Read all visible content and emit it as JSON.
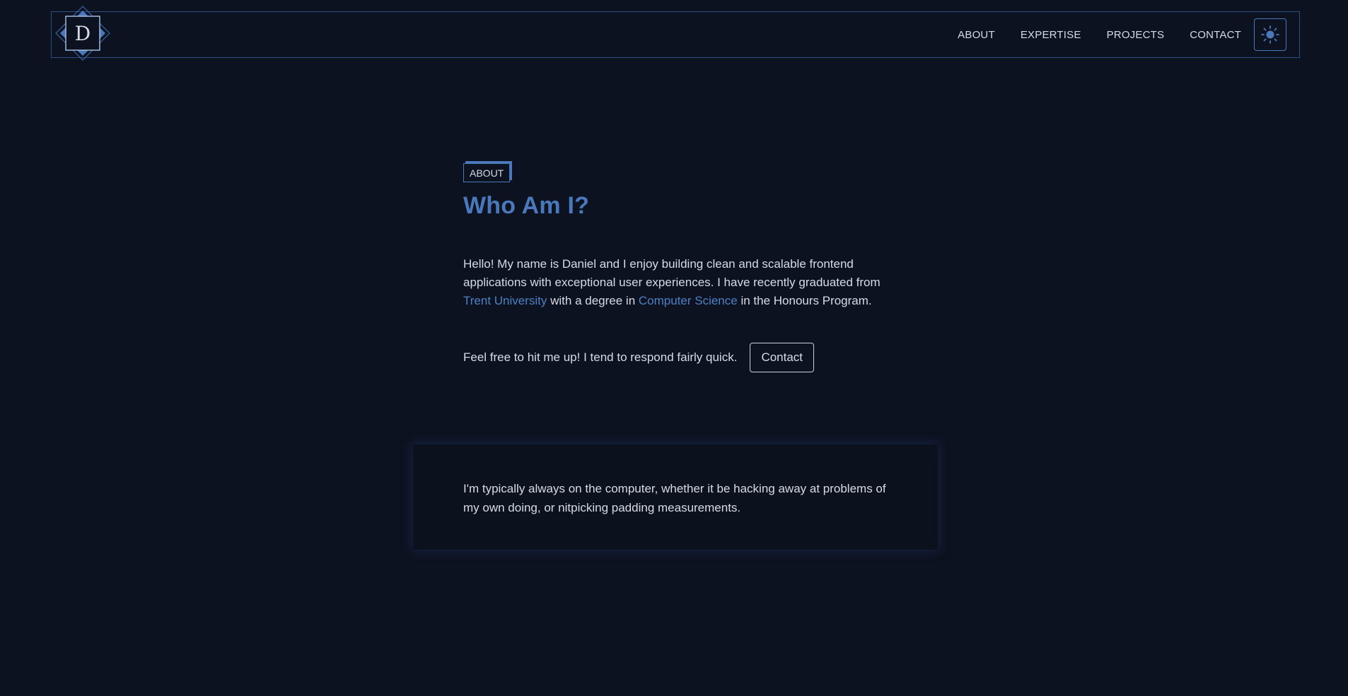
{
  "logo": {
    "letter": "D",
    "icon": "diamond-logo-icon"
  },
  "nav": {
    "items": [
      {
        "label": "ABOUT"
      },
      {
        "label": "EXPERTISE"
      },
      {
        "label": "PROJECTS"
      },
      {
        "label": "CONTACT"
      }
    ],
    "theme_toggle_icon": "sun-icon"
  },
  "about": {
    "tag": "ABOUT",
    "title": "Who Am I?",
    "intro": {
      "part1": "Hello! My name is Daniel and I enjoy building clean and scalable frontend applications with exceptional user experiences. I have recently graduated from ",
      "link1": "Trent University",
      "part2": " with a degree in ",
      "link2": "Computer Science",
      "part3": " in the Honours Program."
    },
    "cta_text": "Feel free to hit me up! I tend to respond fairly quick.",
    "contact_button": "Contact"
  },
  "card": {
    "text": "I'm typically always on the computer, whether it be hacking away at problems of my own doing, or nitpicking padding measurements."
  },
  "colors": {
    "background": "#0d1220",
    "accent": "#4a78bb",
    "text": "#d7dbe5"
  }
}
